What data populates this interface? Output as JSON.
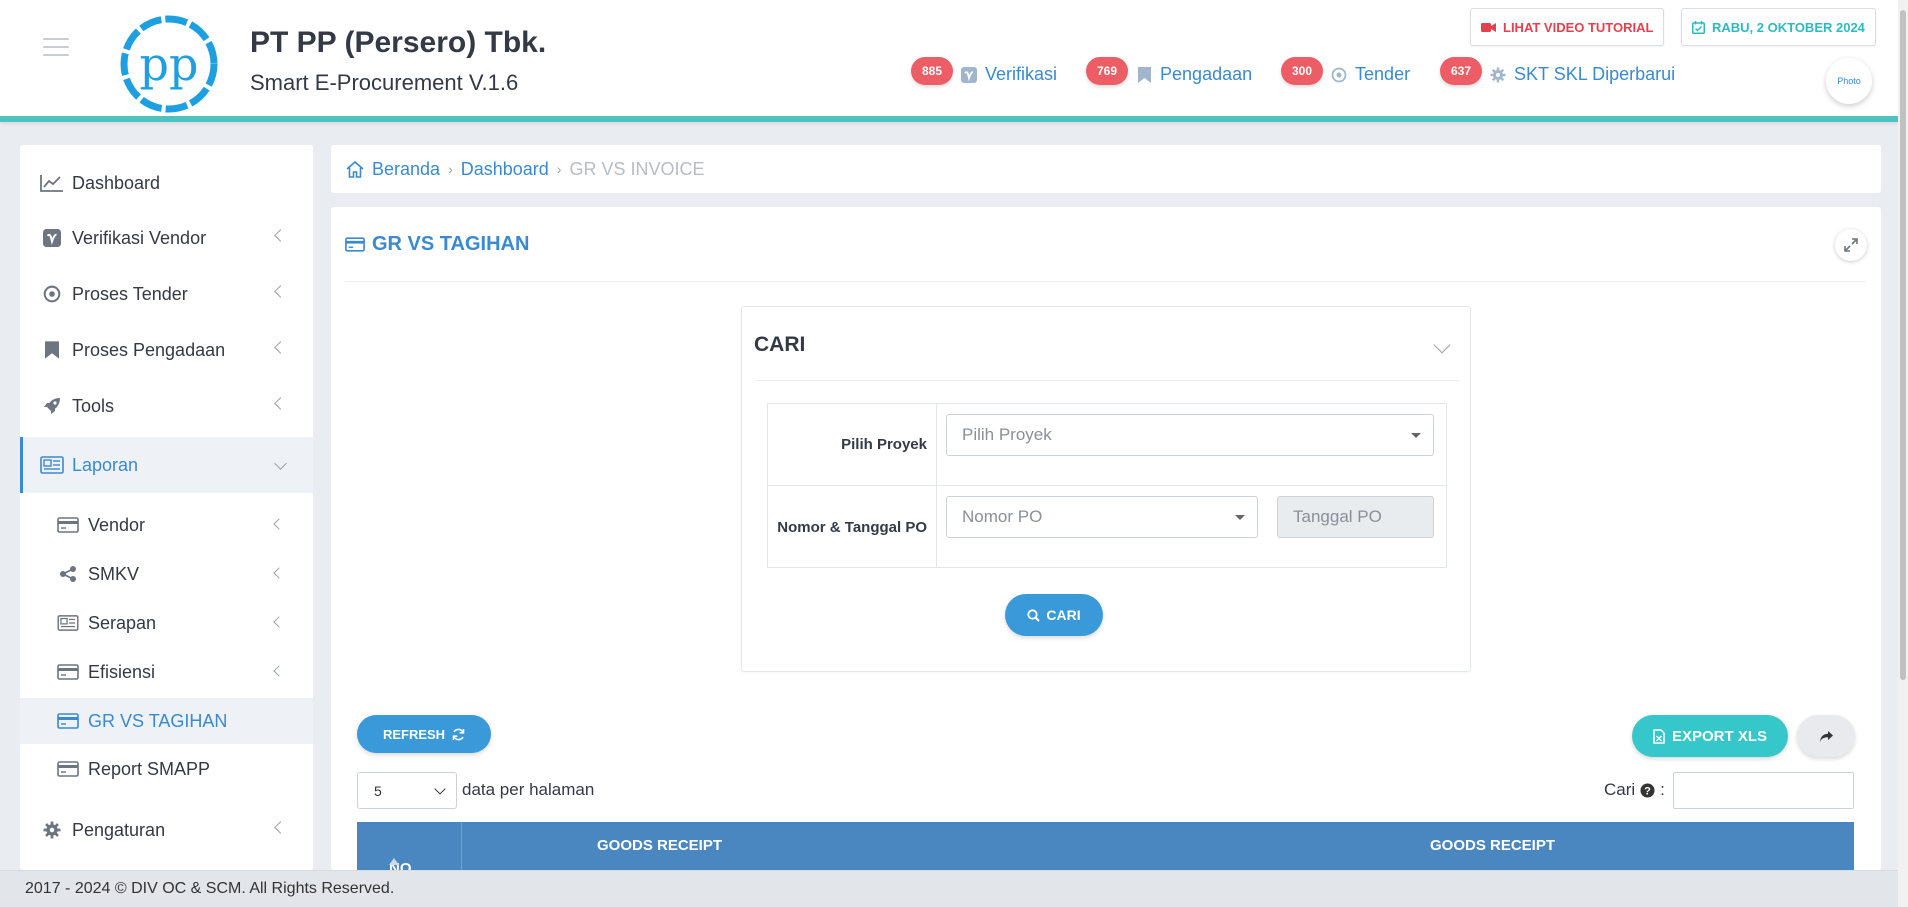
{
  "header": {
    "company": "PT PP (Persero) Tbk.",
    "app_name": "Smart E-Procurement V.1.6",
    "logo_text": "pp",
    "video_tutorial": "LIHAT VIDEO TUTORIAL",
    "date": "RABU, 2 OKTOBER 2024",
    "avatar_alt": "Photo",
    "notifications": [
      {
        "count": "885",
        "icon": "vimeo-icon",
        "label": "Verifikasi"
      },
      {
        "count": "769",
        "icon": "bookmark-icon",
        "label": "Pengadaan"
      },
      {
        "count": "300",
        "icon": "target-icon",
        "label": "Tender"
      },
      {
        "count": "637",
        "icon": "gear-icon",
        "label": "SKT SKL Diperbarui"
      }
    ]
  },
  "sidebar": {
    "items": [
      {
        "label": "Dashboard",
        "icon": "line-chart-icon"
      },
      {
        "label": "Verifikasi Vendor",
        "icon": "vimeo-icon"
      },
      {
        "label": "Proses Tender",
        "icon": "target-icon"
      },
      {
        "label": "Proses Pengadaan",
        "icon": "bookmark-icon"
      },
      {
        "label": "Tools",
        "icon": "rocket-icon"
      },
      {
        "label": "Laporan",
        "icon": "newspaper-icon"
      },
      {
        "label": "Pengaturan",
        "icon": "gear-icon"
      }
    ],
    "laporan_sub": [
      {
        "label": "Vendor",
        "icon": "credit-card-icon"
      },
      {
        "label": "SMKV",
        "icon": "share-nodes-icon"
      },
      {
        "label": "Serapan",
        "icon": "newspaper-icon"
      },
      {
        "label": "Efisiensi",
        "icon": "credit-card-icon"
      },
      {
        "label": "GR VS TAGIHAN",
        "icon": "credit-card-icon"
      },
      {
        "label": "Report SMAPP",
        "icon": "credit-card-icon"
      }
    ]
  },
  "breadcrumb": {
    "home": "Beranda",
    "dashboard": "Dashboard",
    "current": "GR VS INVOICE"
  },
  "panel": {
    "title": "GR VS TAGIHAN",
    "search": {
      "title": "CARI",
      "proyek_label": "Pilih Proyek",
      "proyek_placeholder": "Pilih Proyek",
      "po_label": "Nomor & Tanggal PO",
      "po_placeholder": "Nomor PO",
      "tanggal_placeholder": "Tanggal PO",
      "button": "CARI"
    },
    "refresh_label": "REFRESH",
    "export_label": "EXPORT XLS",
    "per_page_value": "5",
    "per_page_label": "data per halaman",
    "search_label": "Cari",
    "table": {
      "col_no": "NO",
      "col_gr1": "GOODS RECEIPT",
      "col_gr2": "GOODS RECEIPT"
    }
  },
  "footer": {
    "text": "2017 - 2024 © DIV OC & SCM. All Rights Reserved."
  },
  "colors": {
    "accent": "#3a8ad1",
    "teal": "#35c7c9",
    "badge": "#ec5d66",
    "table_header": "#4a86bf"
  }
}
